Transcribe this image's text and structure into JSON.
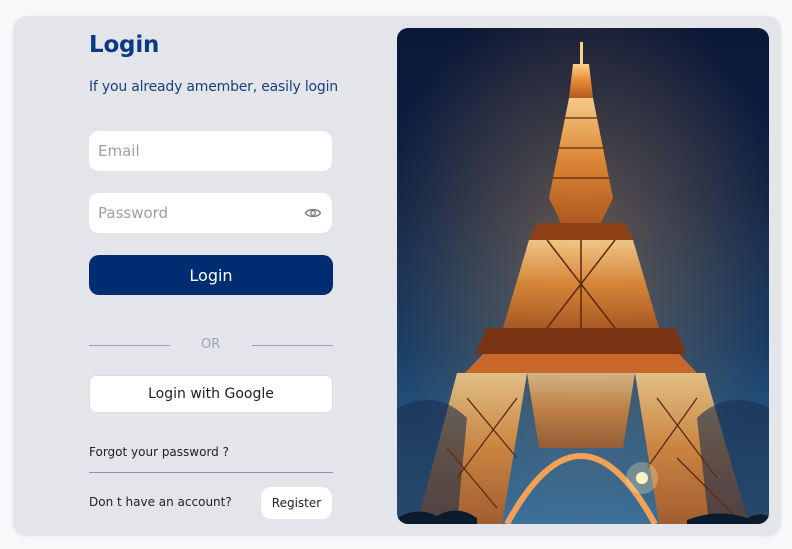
{
  "login": {
    "title": "Login",
    "subtitle": "If you already amember, easily login",
    "email_placeholder": "Email",
    "password_placeholder": "Password",
    "login_button_label": "Login",
    "divider_text": "OR",
    "google_button_label": "Login with Google",
    "forgot_password_label": "Forgot your password ?",
    "no_account_text": "Don t have an account?",
    "register_button_label": "Register"
  },
  "icons": {
    "password_toggle": "eye-icon"
  },
  "colors": {
    "accent": "#002d72",
    "title": "#0b3a84",
    "card_background": "#e4e5ea"
  }
}
